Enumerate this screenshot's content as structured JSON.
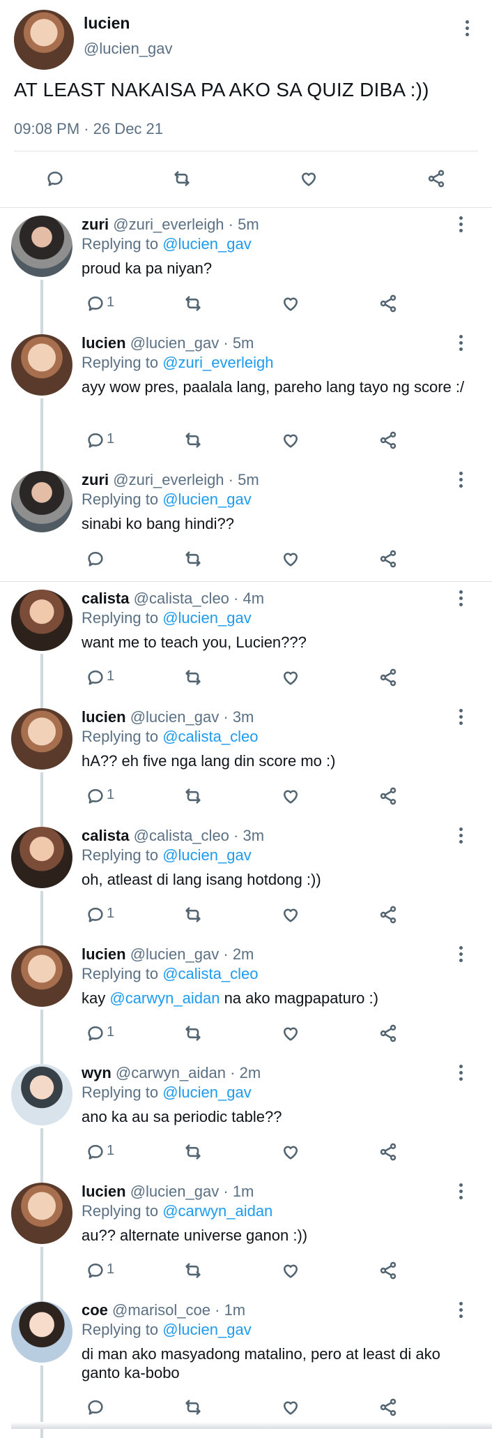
{
  "main": {
    "name": "lucien",
    "handle": "@lucien_gav",
    "text": "AT LEAST NAKAISA PA AKO SA QUIZ DIBA :))",
    "timestamp": "09:08 PM · 26 Dec 21",
    "actions": [
      "reply-icon",
      "retweet-icon",
      "like-icon",
      "share-icon"
    ]
  },
  "replies": [
    {
      "name": "zuri",
      "handle": "@zuri_everleigh",
      "time": "5m",
      "replying_label": "Replying to",
      "replying_to": "@lucien_gav",
      "text": "proud ka pa niyan?",
      "reply_count": "1"
    },
    {
      "name": "lucien",
      "handle": "@lucien_gav",
      "time": "5m",
      "replying_label": "Replying to",
      "replying_to": "@zuri_everleigh",
      "text": "ayy wow pres, paalala lang, pareho lang tayo ng score :/",
      "reply_count": "1"
    },
    {
      "name": "zuri",
      "handle": "@zuri_everleigh",
      "time": "5m",
      "replying_label": "Replying to",
      "replying_to": "@lucien_gav",
      "text": "sinabi ko bang hindi??",
      "reply_count": ""
    },
    {
      "name": "calista",
      "handle": "@calista_cleo",
      "time": "4m",
      "replying_label": "Replying to",
      "replying_to": "@lucien_gav",
      "text": "want me to teach you, Lucien???",
      "reply_count": "1"
    },
    {
      "name": "lucien",
      "handle": "@lucien_gav",
      "time": "3m",
      "replying_label": "Replying to",
      "replying_to": "@calista_cleo",
      "text": "hA?? eh five nga lang din score mo :)",
      "reply_count": "1"
    },
    {
      "name": "calista",
      "handle": "@calista_cleo",
      "time": "3m",
      "replying_label": "Replying to",
      "replying_to": "@lucien_gav",
      "text": "oh, atleast di lang isang hotdong :))",
      "reply_count": "1"
    },
    {
      "name": "lucien",
      "handle": "@lucien_gav",
      "time": "2m",
      "replying_label": "Replying to",
      "replying_to": "@calista_cleo",
      "text_before": "kay ",
      "text_mention": "@carwyn_aidan",
      "text_after": " na ako magpapaturo :)",
      "reply_count": "1"
    },
    {
      "name": "wyn",
      "handle": "@carwyn_aidan",
      "time": "2m",
      "replying_label": "Replying to",
      "replying_to": "@lucien_gav",
      "text": "ano ka au sa periodic table??",
      "reply_count": "1"
    },
    {
      "name": "lucien",
      "handle": "@lucien_gav",
      "time": "1m",
      "replying_label": "Replying to",
      "replying_to": "@carwyn_aidan",
      "text": "au?? alternate universe ganon :))",
      "reply_count": "1"
    },
    {
      "name": "coe",
      "handle": "@marisol_coe",
      "time": "1m",
      "replying_label": "Replying to",
      "replying_to": "@lucien_gav",
      "text": "di man ako masyadong matalino, pero at least di ako ganto ka-bobo",
      "reply_count": ""
    }
  ],
  "colors": {
    "link": "#1d9bf0",
    "muted": "#5b7083",
    "icon": "#536471",
    "divider": "#dfe3e6"
  },
  "separator": "·"
}
